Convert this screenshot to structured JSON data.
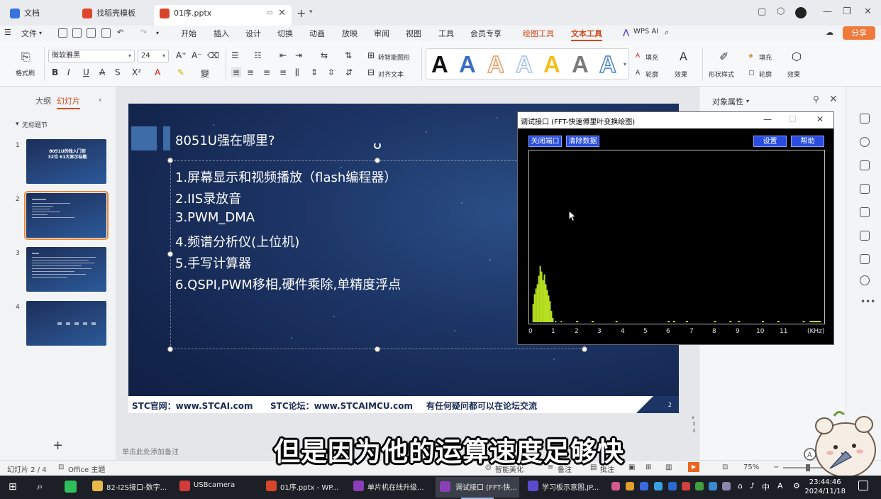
{
  "titlebar": {
    "tabs": [
      {
        "label": "文档",
        "color": "#3a72e0"
      },
      {
        "label": "找稻壳模板",
        "color": "#e0462c"
      },
      {
        "label": "01序.pptx",
        "color": "#d7462a"
      }
    ]
  },
  "menubar": {
    "file": "文件",
    "items": [
      "开始",
      "插入",
      "设计",
      "切换",
      "动画",
      "放映",
      "审阅",
      "视图",
      "工具",
      "会员专享",
      "绘图工具",
      "文本工具"
    ],
    "wps_ai": "WPS AI",
    "share": "分享"
  },
  "ribbon": {
    "format_painter": "格式刷",
    "font_name": "微软雅黑",
    "font_size": "24",
    "smart_graphic": "转智能图形",
    "align_text": "对齐文本",
    "fill": "填充",
    "outline": "轮廓",
    "effect": "效果",
    "shape_style": "形状样式",
    "shape_fill": "填充",
    "shape_outline": "轮廓",
    "shape_effect": "效果",
    "art_colors": [
      "#111111",
      "#3b6fc4",
      "#e69b5e",
      "#a8c2e8",
      "#f0c020",
      "#7a7a7a",
      "#4a80d0"
    ]
  },
  "leftpanel": {
    "tab_outline": "大纲",
    "tab_slides": "幻灯片",
    "section": "无标题节",
    "slides": [
      {
        "num": "1",
        "title": "8051U的独入门到32位 61大显示标题"
      },
      {
        "num": "2",
        "title": ""
      },
      {
        "num": "3",
        "title": ""
      },
      {
        "num": "4",
        "title": ""
      }
    ]
  },
  "slide": {
    "title": "8051U强在哪里?",
    "bullets": [
      "1.屏幕显示和视频播放（flash编程器）",
      "2.IIS录放音",
      "3.PWM_DMA",
      "4.频谱分析仪(上位机)",
      "5.手写计算器",
      "6.QSPI,PWM移相,硬件乘除,单精度浮点"
    ],
    "footer_left": "STC官网：www.STCAI.com",
    "footer_mid": "STC论坛：www.STCAIMCU.com",
    "footer_right": "有任何疑问都可以在论坛交流",
    "page": "2"
  },
  "notes_placeholder": "单击此处添加备注",
  "rightpanel": {
    "title": "对象属性"
  },
  "statusbar": {
    "slide_info": "幻灯片 2 / 4",
    "theme": "Office 主题",
    "beautify": "智能美化",
    "notes": "备注",
    "comments": "批注",
    "zoom": "75%"
  },
  "fft": {
    "title": "调试接口 (FFT-快速傅里叶变换绘图)",
    "btn_close_port": "关闭端口",
    "btn_clear": "清除数据",
    "btn_settings": "设置",
    "btn_help": "帮助",
    "x_ticks": [
      "0",
      "1",
      "2",
      "3",
      "4",
      "5",
      "6",
      "7",
      "8",
      "9",
      "10",
      "11",
      "(KHz)"
    ],
    "bar_color": "#b6e020"
  },
  "subtitle": "但是因为他的运算速度足够快",
  "taskbar": {
    "items": [
      {
        "label": "82-I2S接口-数字...",
        "color": "#e8b84a"
      },
      {
        "label": "USBcamera",
        "color": "#d33a3a"
      },
      {
        "label": "01序.pptx - WP...",
        "color": "#d7462a"
      },
      {
        "label": "单片机在线升级...",
        "color": "#8a3fb8"
      },
      {
        "label": "调试接口 (FFT-快...",
        "color": "#8a3fb8"
      },
      {
        "label": "学习板示意图.JP...",
        "color": "#5a4ad0"
      }
    ],
    "time": "23:44:46",
    "date": "2024/11/18"
  }
}
